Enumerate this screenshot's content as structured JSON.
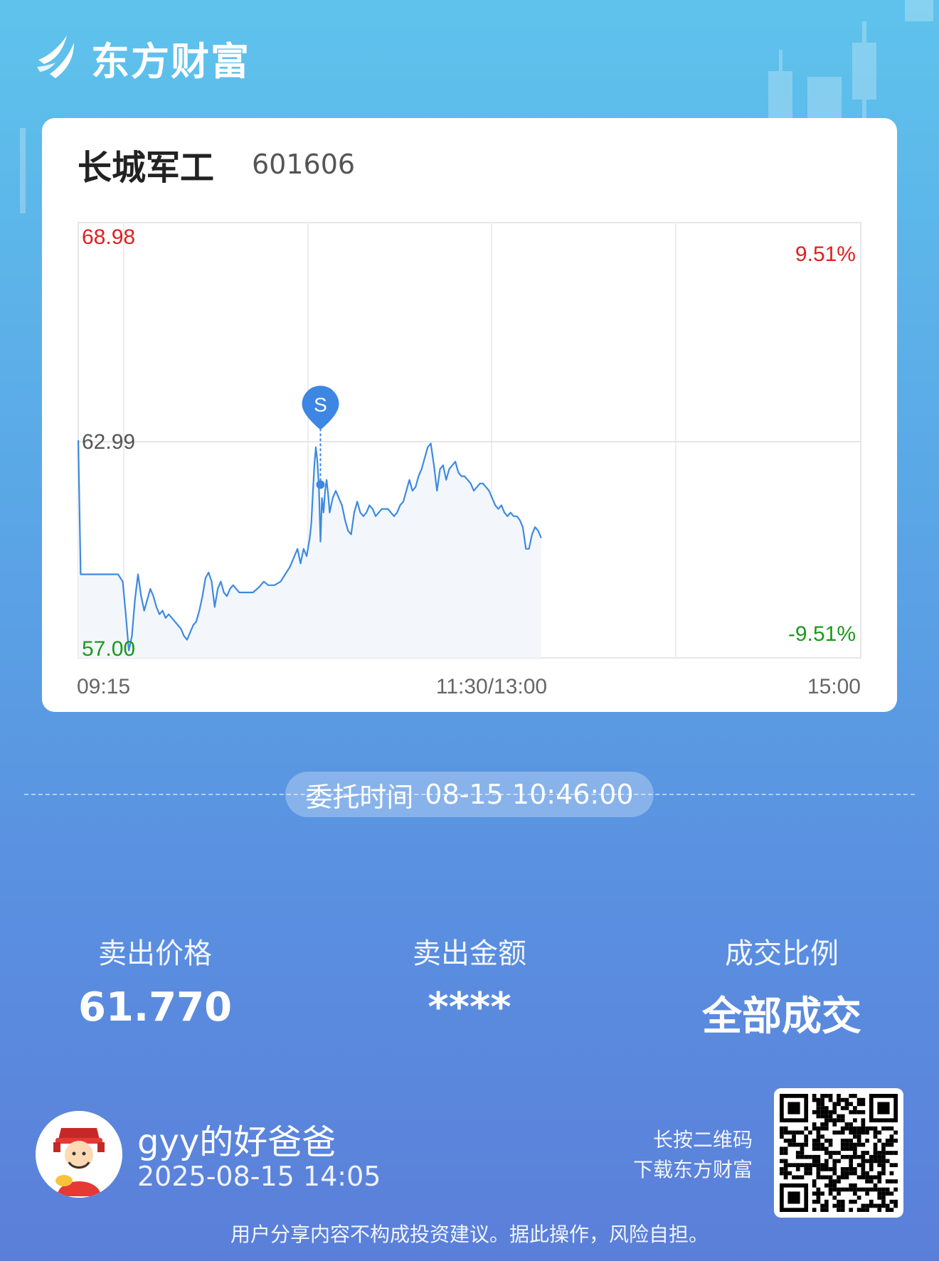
{
  "brand": {
    "name": "东方财富",
    "logo_icon": "eastmoney-logo-icon"
  },
  "stock": {
    "name": "长城军工",
    "code": "601606"
  },
  "chart_data": {
    "type": "line",
    "y_labels": {
      "max": "68.98",
      "prev_close": "62.99",
      "min": "57.00"
    },
    "pct_labels": {
      "max": "9.51%",
      "min": "-9.51%"
    },
    "ylim": [
      57.0,
      68.98
    ],
    "x_labels": [
      "09:15",
      "11:30/13:00",
      "15:00"
    ],
    "series": [
      {
        "values": [
          [
            0,
            62.99
          ],
          [
            0.8,
            59.3
          ],
          [
            13,
            59.3
          ],
          [
            14.5,
            59.1
          ],
          [
            15.5,
            58.2
          ],
          [
            16.5,
            57.2
          ],
          [
            17.5,
            57.6
          ],
          [
            18.5,
            58.6
          ],
          [
            19.5,
            59.3
          ],
          [
            20.5,
            58.7
          ],
          [
            21.5,
            58.3
          ],
          [
            22.5,
            58.6
          ],
          [
            23.5,
            58.9
          ],
          [
            24.5,
            58.7
          ],
          [
            25.5,
            58.4
          ],
          [
            26.5,
            58.2
          ],
          [
            27.5,
            58.3
          ],
          [
            28.5,
            58.1
          ],
          [
            29.5,
            58.2
          ],
          [
            30.5,
            58.1
          ],
          [
            31.5,
            58.0
          ],
          [
            32.5,
            57.9
          ],
          [
            33.5,
            57.8
          ],
          [
            34.5,
            57.6
          ],
          [
            35.5,
            57.5
          ],
          [
            36.5,
            57.7
          ],
          [
            37.5,
            57.9
          ],
          [
            38.5,
            58.0
          ],
          [
            39.5,
            58.3
          ],
          [
            40.5,
            58.7
          ],
          [
            41.5,
            59.2
          ],
          [
            42.5,
            59.35
          ],
          [
            43.5,
            59.1
          ],
          [
            44.5,
            58.4
          ],
          [
            45.5,
            58.9
          ],
          [
            46.5,
            59.1
          ],
          [
            47.5,
            58.8
          ],
          [
            48.5,
            58.7
          ],
          [
            49.5,
            58.9
          ],
          [
            50.5,
            59.0
          ],
          [
            51.5,
            58.9
          ],
          [
            52.5,
            58.8
          ],
          [
            53.5,
            58.8
          ],
          [
            55,
            58.8
          ],
          [
            57,
            58.8
          ],
          [
            59,
            58.95
          ],
          [
            60.5,
            59.1
          ],
          [
            62,
            59.0
          ],
          [
            64,
            59.0
          ],
          [
            66,
            59.1
          ],
          [
            67.5,
            59.3
          ],
          [
            69,
            59.5
          ],
          [
            70.5,
            59.8
          ],
          [
            71.5,
            60.0
          ],
          [
            72.5,
            59.6
          ],
          [
            73.5,
            60.0
          ],
          [
            74.5,
            59.8
          ],
          [
            75.5,
            60.3
          ],
          [
            76,
            60.7
          ],
          [
            76.5,
            61.5
          ],
          [
            77,
            62.3
          ],
          [
            77.5,
            62.8
          ],
          [
            78,
            62.4
          ],
          [
            78.5,
            61.7
          ],
          [
            79,
            60.2
          ],
          [
            79.5,
            61.4
          ],
          [
            80,
            61.0
          ],
          [
            80.5,
            61.6
          ],
          [
            81,
            61.9
          ],
          [
            81.5,
            61.5
          ],
          [
            82,
            61.0
          ],
          [
            83,
            61.4
          ],
          [
            84,
            61.6
          ],
          [
            85,
            61.4
          ],
          [
            86,
            61.2
          ],
          [
            87,
            60.8
          ],
          [
            88,
            60.5
          ],
          [
            89,
            60.4
          ],
          [
            90,
            61.0
          ],
          [
            91,
            61.3
          ],
          [
            92,
            61.0
          ],
          [
            93,
            60.9
          ],
          [
            94,
            61.0
          ],
          [
            95,
            61.2
          ],
          [
            96,
            61.1
          ],
          [
            97,
            60.9
          ],
          [
            98,
            61.0
          ],
          [
            99,
            61.1
          ],
          [
            100,
            61.1
          ],
          [
            101,
            61.1
          ],
          [
            102,
            61.0
          ],
          [
            103,
            60.9
          ],
          [
            104,
            61.0
          ],
          [
            105,
            61.2
          ],
          [
            106,
            61.3
          ],
          [
            107,
            61.6
          ],
          [
            108,
            61.9
          ],
          [
            109,
            61.6
          ],
          [
            110,
            61.7
          ],
          [
            111,
            62.0
          ],
          [
            112,
            62.2
          ],
          [
            113,
            62.5
          ],
          [
            114,
            62.8
          ],
          [
            115,
            62.9
          ],
          [
            116,
            62.3
          ],
          [
            117,
            61.6
          ],
          [
            118,
            62.2
          ],
          [
            119,
            62.3
          ],
          [
            120,
            61.9
          ],
          [
            121,
            62.2
          ],
          [
            122,
            62.3
          ],
          [
            123,
            62.4
          ],
          [
            124,
            62.1
          ],
          [
            125,
            62.0
          ],
          [
            126,
            62.0
          ],
          [
            127,
            61.9
          ],
          [
            128,
            61.8
          ],
          [
            129,
            61.6
          ],
          [
            130,
            61.7
          ],
          [
            131,
            61.8
          ],
          [
            132,
            61.8
          ],
          [
            133,
            61.7
          ],
          [
            134,
            61.6
          ],
          [
            135,
            61.4
          ],
          [
            136,
            61.2
          ],
          [
            137,
            61.1
          ],
          [
            138,
            61.2
          ],
          [
            139,
            61.0
          ],
          [
            140,
            60.9
          ],
          [
            141,
            61.0
          ],
          [
            142,
            60.9
          ],
          [
            143,
            60.9
          ],
          [
            144,
            60.8
          ],
          [
            145,
            60.6
          ],
          [
            146,
            60.0
          ],
          [
            147,
            60.0
          ],
          [
            148,
            60.4
          ],
          [
            149,
            60.6
          ],
          [
            150,
            60.5
          ],
          [
            151,
            60.3
          ]
        ]
      }
    ],
    "marker": {
      "label": "S",
      "time_index": 79,
      "price": 61.77
    }
  },
  "order_time": {
    "label": "委托时间",
    "value": "08-15 10:46:00"
  },
  "stats": [
    {
      "label": "卖出价格",
      "value": "61.770"
    },
    {
      "label": "卖出金额",
      "value": "****"
    },
    {
      "label": "成交比例",
      "value": "全部成交"
    }
  ],
  "user": {
    "name": "gyy的好爸爸",
    "time": "2025-08-15 14:05",
    "avatar_icon": "caishen-avatar-icon"
  },
  "qr": {
    "line1": "长按二维码",
    "line2": "下载东方财富"
  },
  "disclaimer": "用户分享内容不构成投资建议。据此操作，风险自担。",
  "colors": {
    "up": "#e02020",
    "down": "#1a9a1a",
    "line": "#3d8ae0",
    "marker": "#3d86e3"
  }
}
